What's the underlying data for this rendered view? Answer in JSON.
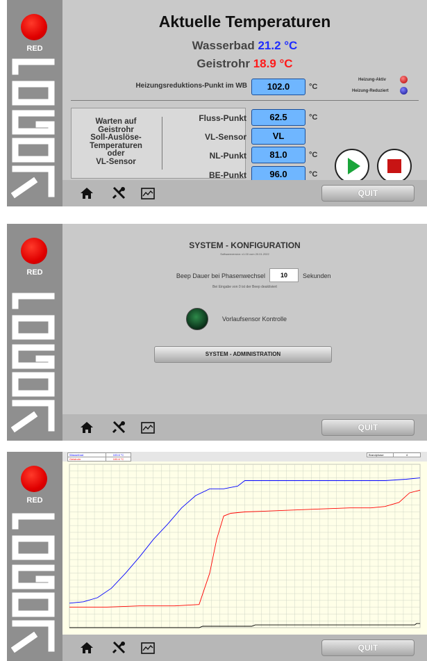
{
  "brand": {
    "label": "RED",
    "colors": {
      "led": "#e00000",
      "sidebar": "#8f8f8f"
    }
  },
  "nav": {
    "home_icon": "home-icon",
    "tools_icon": "tools-icon",
    "chart_icon": "chart-icon",
    "quit_label": "QUIT"
  },
  "screen1": {
    "title": "Aktuelle Temperaturen",
    "wasserbad_label": "Wasserbad",
    "wasserbad_value": "21.2 °C",
    "geistrohr_label": "Geistrohr",
    "geistrohr_value": "18.9 °C",
    "heizungs_label": "Heizungsreduktions-Punkt im WB",
    "heizungs_value": "102.0",
    "unit_c": "°C",
    "heizung_aktiv": "Heizung-Aktiv",
    "heizung_reduziert": "Heizung-Reduziert",
    "status_lines": [
      "Warten auf",
      "Geistrohr",
      "Soll-Auslöse-",
      "Temperaturen",
      "oder",
      "VL-Sensor"
    ],
    "params": [
      {
        "label": "Fluss-Punkt",
        "value": "62.5",
        "unit": "°C"
      },
      {
        "label": "VL-Sensor",
        "value": "VL",
        "unit": ""
      },
      {
        "label": "NL-Punkt",
        "value": "81.0",
        "unit": "°C"
      },
      {
        "label": "BE-Punkt",
        "value": "96.0",
        "unit": "°C"
      }
    ],
    "play_icon": "play-icon",
    "stop_icon": "stop-icon"
  },
  "screen2": {
    "title": "SYSTEM - KONFIGURATION",
    "version": "Softwareversion: v1.00 vom 20.01.2022",
    "beep_label": "Beep Dauer bei Phasenwechsel",
    "beep_value": "10",
    "beep_unit": "Sekunden",
    "beep_note": "Bei Eingabe von 0 ist der Beep deaktiviert",
    "vl_label": "Vorlaufsensor Kontrolle",
    "admin_label": "SYSTEM - ADMINISTRATION"
  },
  "screen3": {
    "legend": [
      {
        "name": "Wasserbad",
        "value": "103.6 °C",
        "color": "#0000ff"
      },
      {
        "name": "Geistrohr",
        "value": "100.6 °C",
        "color": "#ff0000"
      }
    ],
    "phase_label": "Brandphase",
    "phase_value": "4"
  },
  "chart_data": {
    "type": "line",
    "ylim": [
      0,
      120
    ],
    "grid": true,
    "series": [
      {
        "name": "Wasserbad",
        "color": "#0000ff",
        "x": [
          0,
          0.04,
          0.08,
          0.12,
          0.16,
          0.2,
          0.24,
          0.28,
          0.32,
          0.36,
          0.4,
          0.44,
          0.48,
          0.5,
          0.52,
          0.56,
          0.6,
          0.7,
          0.8,
          0.9,
          0.96,
          1.0
        ],
        "y": [
          18,
          19,
          22,
          29,
          40,
          52,
          65,
          76,
          88,
          97,
          102,
          102,
          104,
          108,
          108,
          108,
          108,
          108,
          108,
          108,
          109,
          110
        ]
      },
      {
        "name": "Geistrohr",
        "color": "#ff0000",
        "x": [
          0,
          0.1,
          0.2,
          0.3,
          0.37,
          0.4,
          0.42,
          0.44,
          0.46,
          0.5,
          0.6,
          0.7,
          0.8,
          0.86,
          0.9,
          0.94,
          0.97,
          1.0
        ],
        "y": [
          15,
          15,
          16,
          16,
          17,
          40,
          65,
          82,
          84,
          85,
          86,
          87,
          88,
          88,
          89,
          92,
          99,
          101
        ]
      },
      {
        "name": "Brandphase",
        "color": "#000000",
        "x": [
          0,
          0.37,
          0.38,
          0.52,
          0.53,
          0.985,
          0.99,
          1.0
        ],
        "y": [
          0,
          0,
          1,
          1,
          2,
          2,
          3,
          3
        ]
      }
    ]
  }
}
